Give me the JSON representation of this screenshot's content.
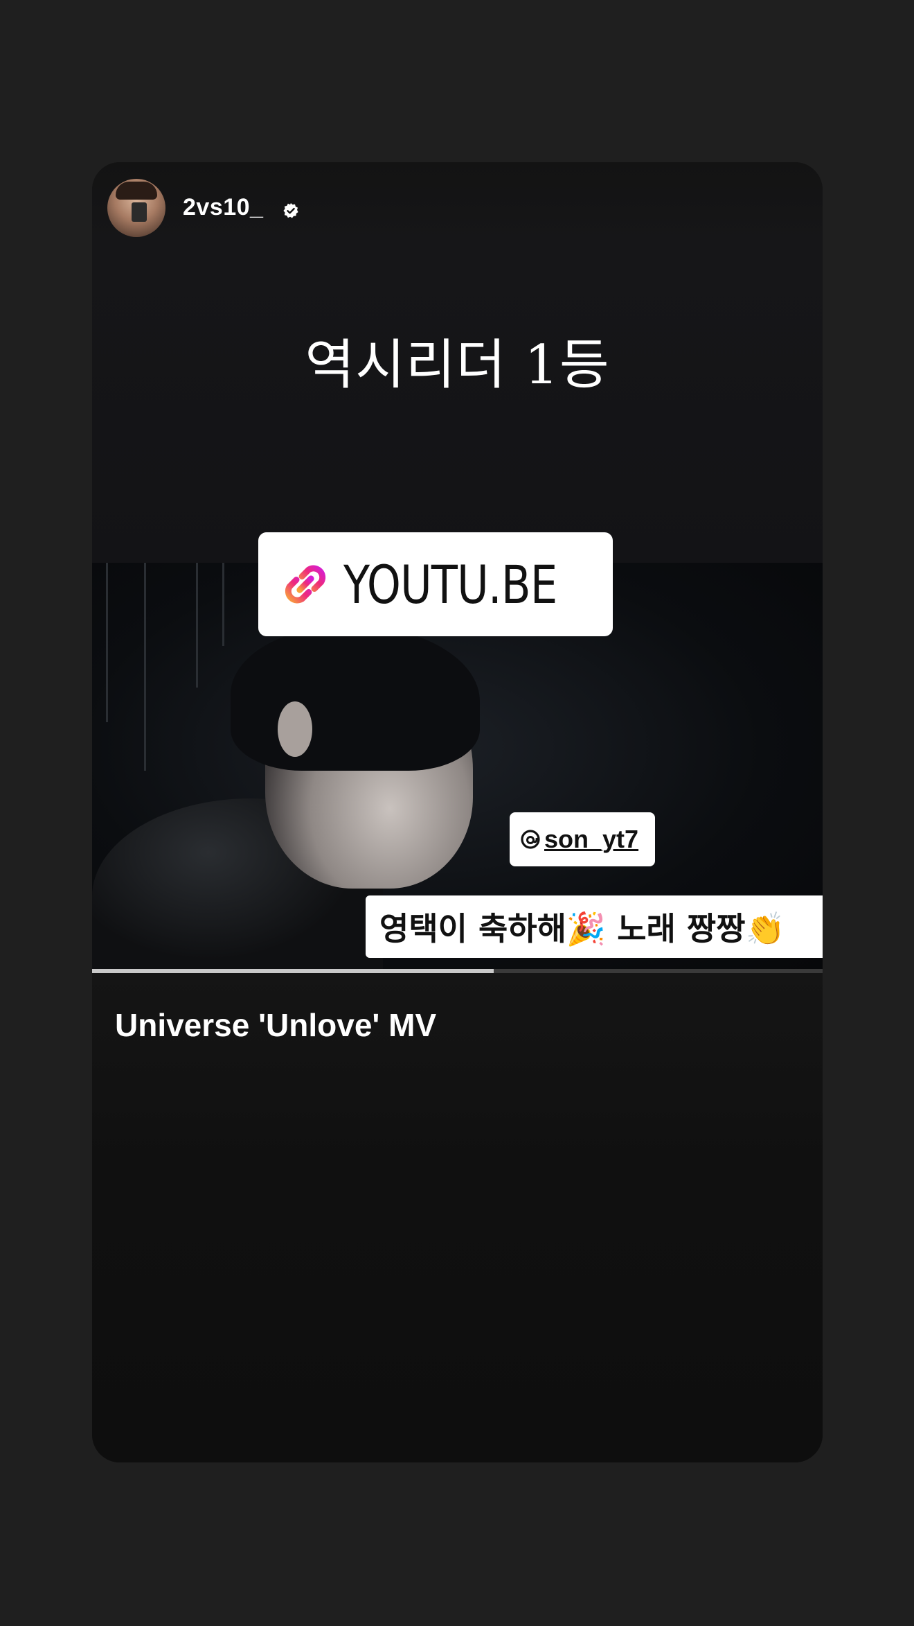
{
  "story": {
    "username": "2vs10_",
    "verified": true,
    "caption": "역시리더 1등",
    "link_sticker": {
      "icon": "link-icon",
      "label": "YOUTU.BE"
    },
    "mention_sticker": {
      "icon": "threads-icon",
      "label": "son_yt7"
    },
    "text_sticker": "영택이 축하해🎉 노래 짱짱👏",
    "video_progress": 0.55,
    "link_preview_title": "Universe 'Unlove' MV"
  },
  "colors": {
    "page_background": "#1f1f1f",
    "story_background": "#101010",
    "sticker_background": "#ffffff",
    "link_gradient_start": "#f9a23a",
    "link_gradient_end": "#d51dd6"
  }
}
